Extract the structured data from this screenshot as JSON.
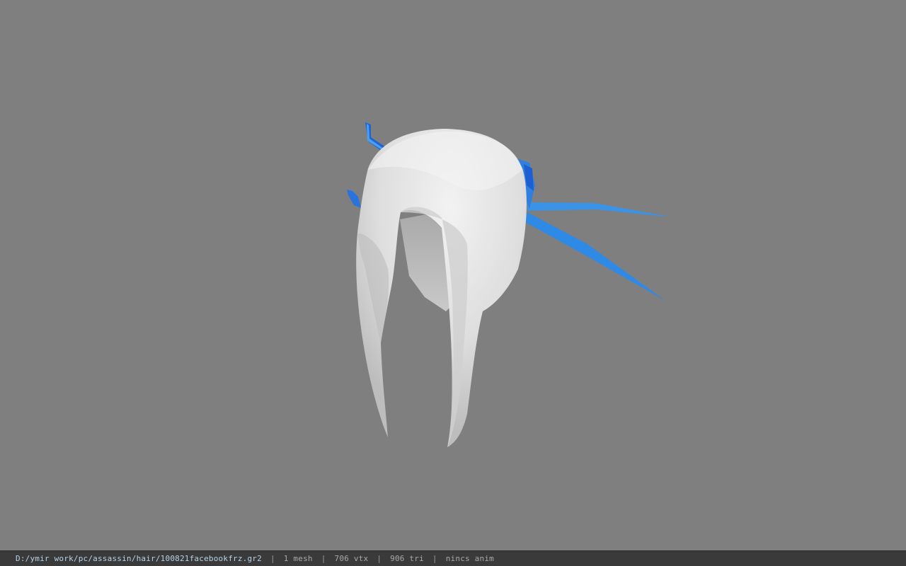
{
  "viewer": {
    "background_color": "#7f7f7f",
    "model_hair_color": "#e6e6e6",
    "model_accent_color": "#2f8ae6"
  },
  "status_bar": {
    "file_path": "D:/ymir work/pc/assassin/hair/100821facebookfrz.gr2",
    "separator": "|",
    "mesh_count": "1 mesh",
    "vertex_count": "706 vtx",
    "triangle_count": "906 tri",
    "anim_status": "nincs anim"
  }
}
